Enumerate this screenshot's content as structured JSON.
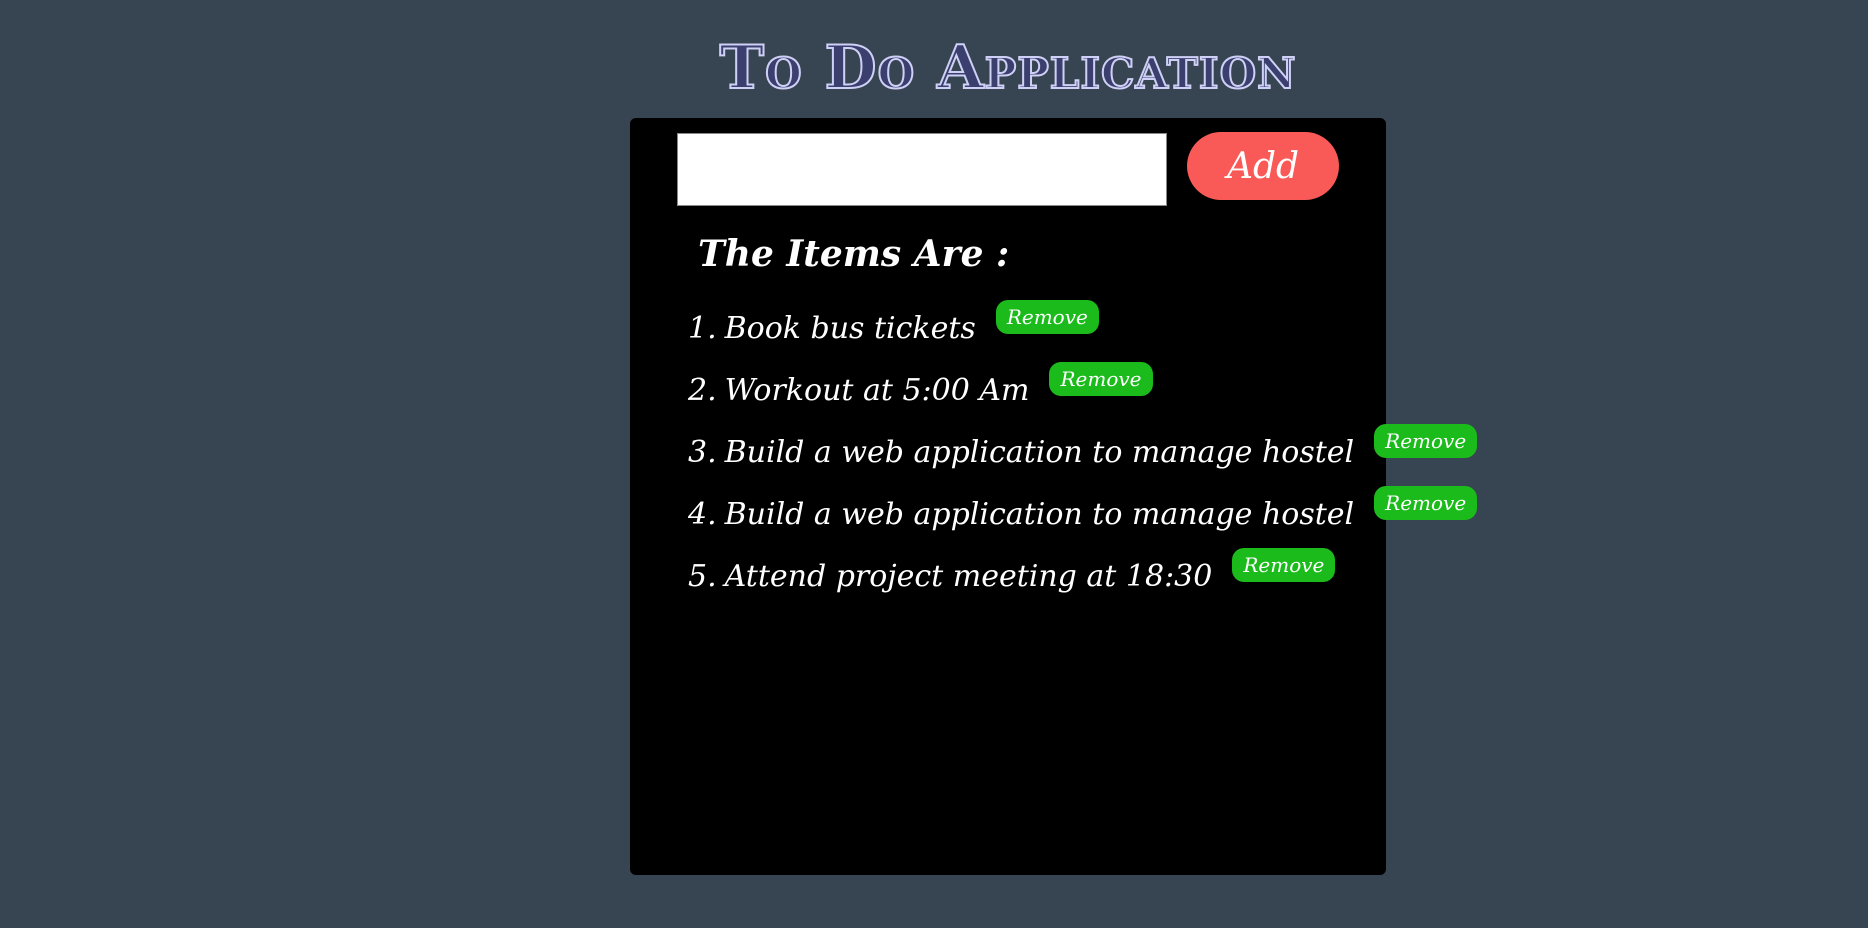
{
  "header": {
    "title": "To Do Application"
  },
  "input": {
    "value": "",
    "placeholder": ""
  },
  "add_button": {
    "label": "Add"
  },
  "list": {
    "heading": "The Items Are :",
    "remove_label": "Remove",
    "items": [
      {
        "number": "1.",
        "text": "Book bus tickets"
      },
      {
        "number": "2.",
        "text": "Workout at 5:00 Am"
      },
      {
        "number": "3.",
        "text": "Build a web application to manage hostel"
      },
      {
        "number": "4.",
        "text": "Build a web application to manage hostel"
      },
      {
        "number": "5.",
        "text": "Attend project meeting at 18:30"
      }
    ]
  },
  "colors": {
    "page_background": "#374451",
    "panel_background": "#000000",
    "title_fill": "#3a3f6e",
    "title_outline": "#cfd0f5",
    "add_button": "#fa5a57",
    "remove_button": "#1cbb1c",
    "text": "#ffffff"
  }
}
